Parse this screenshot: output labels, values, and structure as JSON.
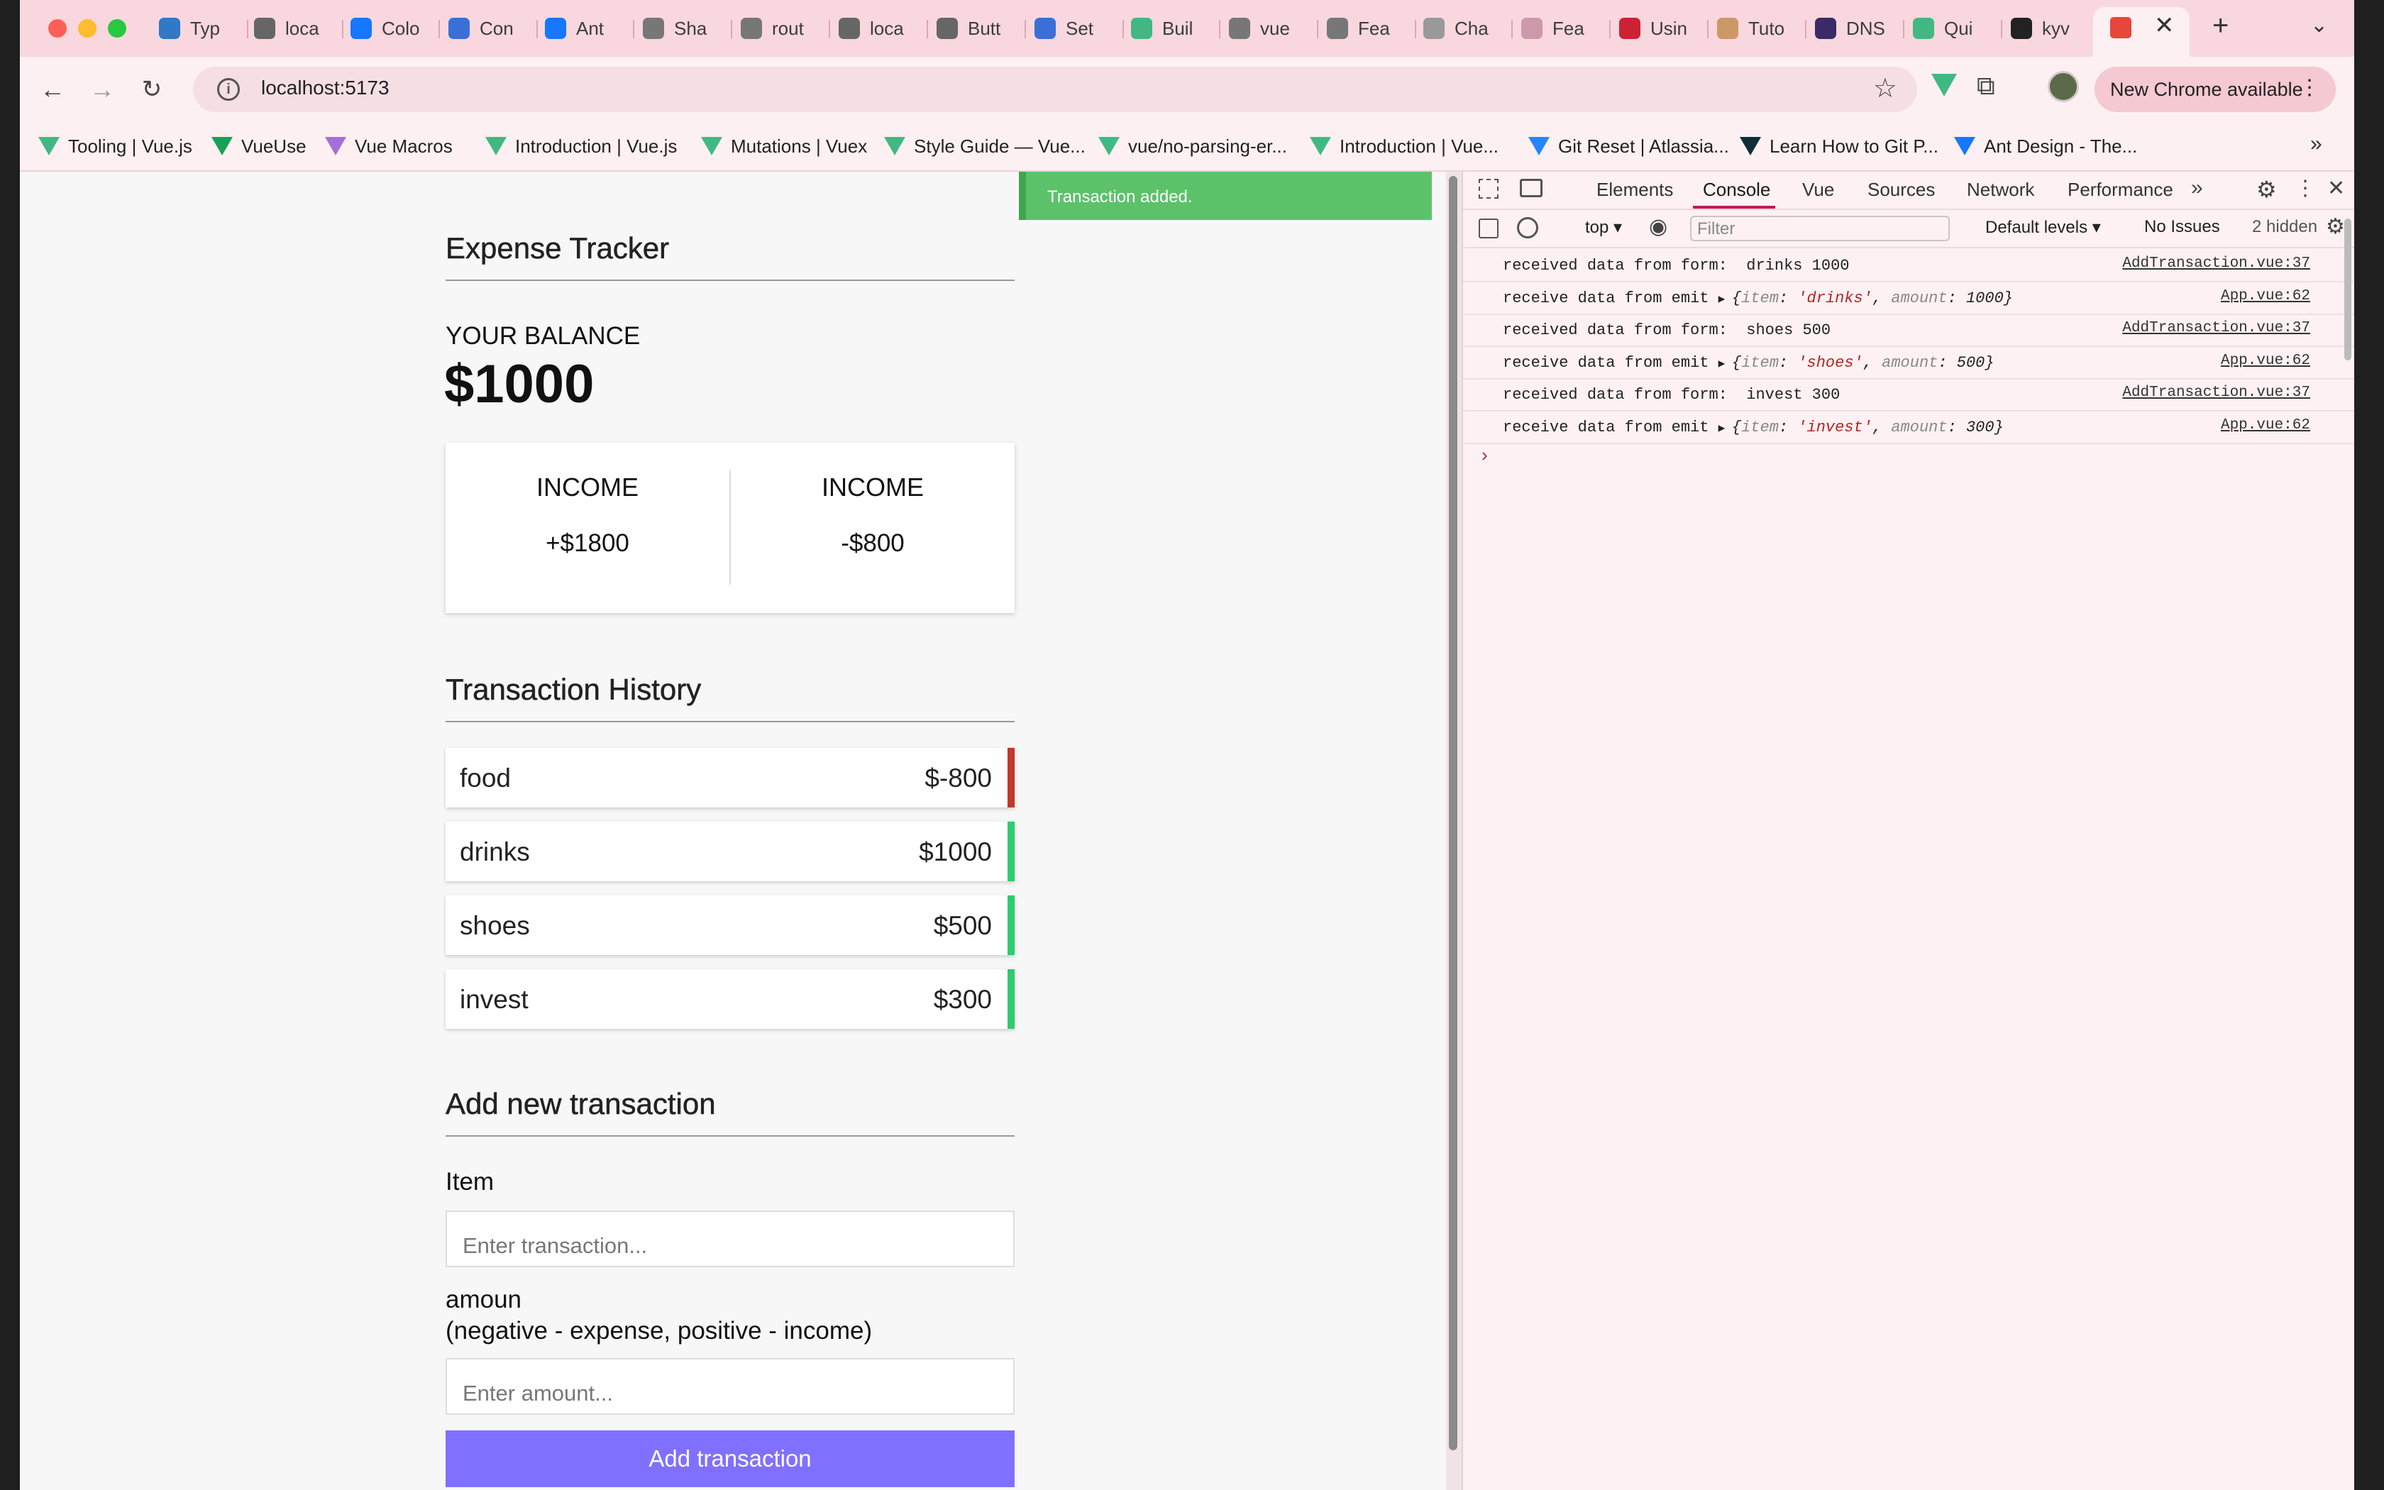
{
  "browser": {
    "tabs": [
      {
        "title": "Typ",
        "icon": "typescript-icon",
        "color": "#3178c6"
      },
      {
        "title": "loca",
        "icon": "globe-icon",
        "color": "#666"
      },
      {
        "title": "Colo",
        "icon": "ant-design-icon",
        "color": "#1677ff"
      },
      {
        "title": "Con",
        "icon": "gear-icon",
        "color": "#3b6fd8"
      },
      {
        "title": "Ant",
        "icon": "ant-design-icon",
        "color": "#1677ff"
      },
      {
        "title": "Sha",
        "icon": "vue-icon",
        "color": "#777"
      },
      {
        "title": "rout",
        "icon": "vue-icon",
        "color": "#777"
      },
      {
        "title": "loca",
        "icon": "globe-icon",
        "color": "#666"
      },
      {
        "title": "Butt",
        "icon": "globe-icon",
        "color": "#666"
      },
      {
        "title": "Set",
        "icon": "settings-icon",
        "color": "#3b6fd8"
      },
      {
        "title": "Buil",
        "icon": "vue-icon",
        "color": "#41b883"
      },
      {
        "title": "vue",
        "icon": "vue-icon",
        "color": "#777"
      },
      {
        "title": "Fea",
        "icon": "vue-icon",
        "color": "#777"
      },
      {
        "title": "Cha",
        "icon": "globe-icon",
        "color": "#999"
      },
      {
        "title": "Fea",
        "icon": "globe-icon",
        "color": "#c9a"
      },
      {
        "title": "Usin",
        "icon": "globe-icon",
        "color": "#c23"
      },
      {
        "title": "Tuto",
        "icon": "globe-icon",
        "color": "#c96"
      },
      {
        "title": "DNS",
        "icon": "n-icon",
        "color": "#3a2a66"
      },
      {
        "title": "Qui",
        "icon": "vue-icon",
        "color": "#41b883"
      },
      {
        "title": "kyv",
        "icon": "github-icon",
        "color": "#222"
      },
      {
        "title": "",
        "icon": "active-tab-icon",
        "color": "#e25"
      }
    ],
    "url": "localhost:5173",
    "new_chrome_label": "New Chrome available",
    "bookmarks": [
      "Tooling | Vue.js",
      "VueUse",
      "Vue Macros",
      "Introduction | Vue.js",
      "Mutations | Vuex",
      "Style Guide — Vue...",
      "vue/no-parsing-er...",
      "Introduction | Vue...",
      "Git Reset | Atlassia...",
      "Learn How to Git P...",
      "Ant Design - The..."
    ]
  },
  "app": {
    "toast": "Transaction added.",
    "title": "Expense Tracker",
    "balance_label": "YOUR BALANCE",
    "balance_value": "$1000",
    "income_label": "INCOME",
    "income_value": "+$1800",
    "expense_label": "INCOME",
    "expense_value": "-$800",
    "history_title": "Transaction History",
    "transactions": [
      {
        "item": "food",
        "amount": "$-800",
        "color": "#c0392b"
      },
      {
        "item": "drinks",
        "amount": "$1000",
        "color": "#2ecc71"
      },
      {
        "item": "shoes",
        "amount": "$500",
        "color": "#2ecc71"
      },
      {
        "item": "invest",
        "amount": "$300",
        "color": "#2ecc71"
      }
    ],
    "add_title": "Add new transaction",
    "item_label": "Item",
    "item_placeholder": "Enter transaction...",
    "amount_label_1": "amoun",
    "amount_label_2": "(negative - expense, positive - income)",
    "amount_placeholder": "Enter amount...",
    "submit_label": "Add transaction"
  },
  "devtools": {
    "tabs": [
      "Elements",
      "Console",
      "Vue",
      "Sources",
      "Network",
      "Performance"
    ],
    "active_tab": "Console",
    "context": "top",
    "filter_placeholder": "Filter",
    "levels": "Default levels",
    "issues": "No Issues",
    "hidden": "2 hidden",
    "logs": [
      {
        "type": "text",
        "msg": "received data from form:  drinks 1000",
        "src": "AddTransaction.vue:37"
      },
      {
        "type": "obj",
        "prefix": "receive data from emit ",
        "item": "'drinks'",
        "amount": "1000",
        "src": "App.vue:62"
      },
      {
        "type": "text",
        "msg": "received data from form:  shoes 500",
        "src": "AddTransaction.vue:37"
      },
      {
        "type": "obj",
        "prefix": "receive data from emit ",
        "item": "'shoes'",
        "amount": "500",
        "src": "App.vue:62"
      },
      {
        "type": "text",
        "msg": "received data from form:  invest 300",
        "src": "AddTransaction.vue:37"
      },
      {
        "type": "obj",
        "prefix": "receive data from emit ",
        "item": "'invest'",
        "amount": "300",
        "src": "App.vue:62"
      }
    ]
  }
}
